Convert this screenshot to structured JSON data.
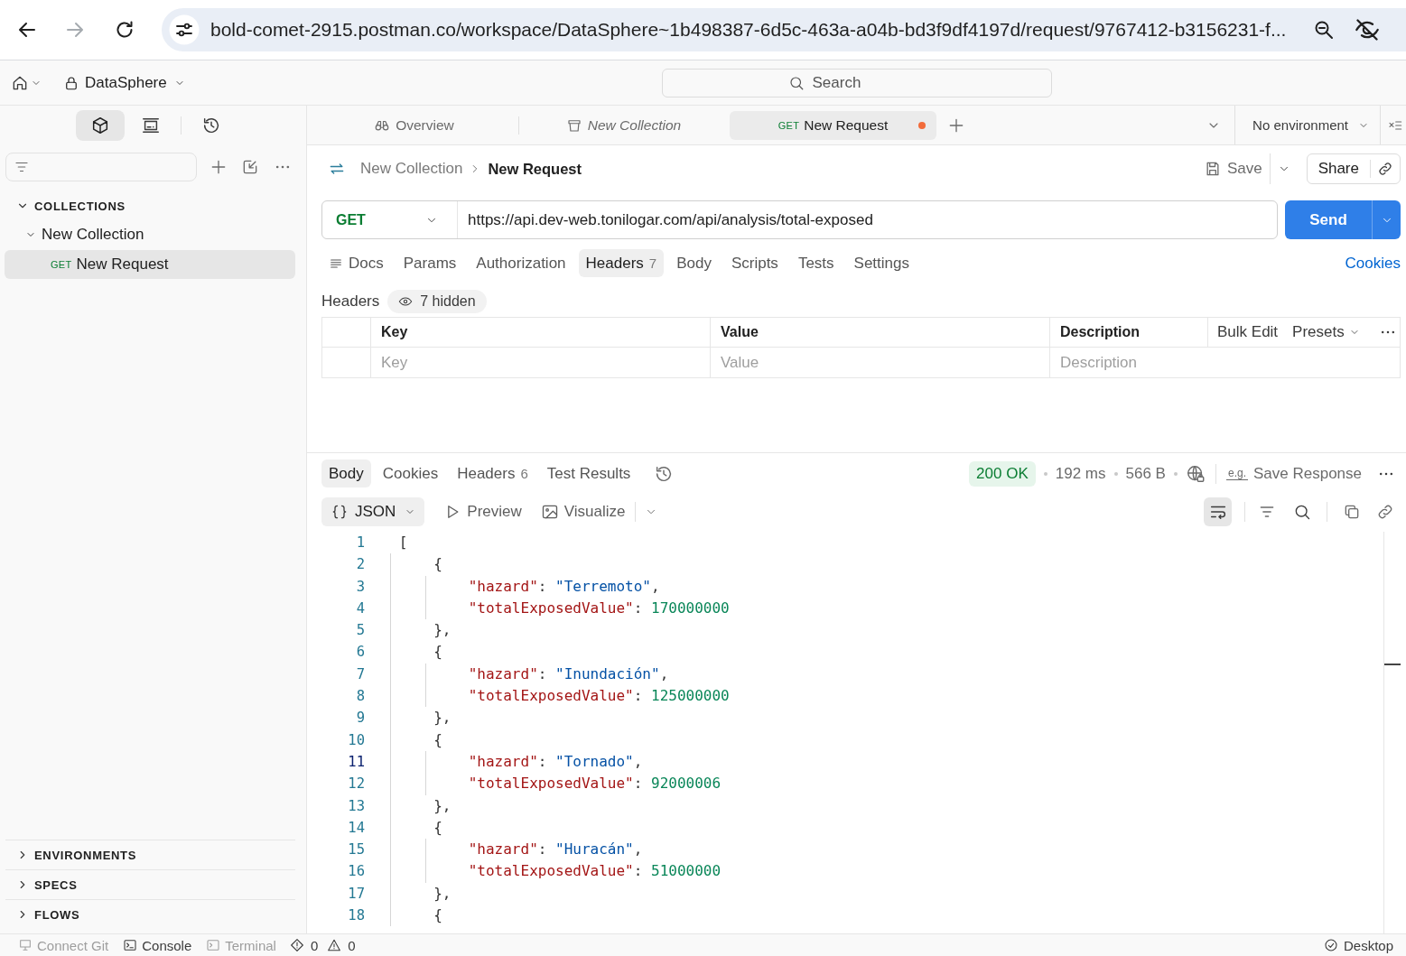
{
  "browser": {
    "url": "bold-comet-2915.postman.co/workspace/DataSphere~1b498387-6d5c-463a-a04b-bd3f9df4197d/request/9767412-b3156231-f...",
    "forward_disabled": true
  },
  "header": {
    "workspace": "DataSphere",
    "search": {
      "placeholder": "Search"
    }
  },
  "sidebar": {
    "icon_tabs": [
      {
        "kind": "collections",
        "selected": true
      },
      {
        "kind": "environments",
        "selected": false
      },
      {
        "kind": "history",
        "selected": false
      }
    ],
    "sections": [
      {
        "label": "COLLECTIONS",
        "expanded": true,
        "children": [
          {
            "label": "New Collection",
            "expanded": true,
            "children": [
              {
                "method": "GET",
                "label": "New Request",
                "selected": true
              }
            ]
          }
        ]
      }
    ],
    "bottom_sections": [
      {
        "label": "ENVIRONMENTS",
        "expanded": false
      },
      {
        "label": "SPECS",
        "expanded": false
      },
      {
        "label": "FLOWS",
        "expanded": false
      }
    ]
  },
  "tabs": [
    {
      "kind": "overview",
      "label": "Overview",
      "selected": false,
      "preview": false,
      "unsaved": false
    },
    {
      "kind": "collection",
      "label": "New Collection",
      "selected": false,
      "preview": true,
      "unsaved": false
    },
    {
      "kind": "request",
      "method": "GET",
      "label": "New Request",
      "selected": true,
      "preview": false,
      "unsaved": true
    }
  ],
  "environment": "No environment",
  "request": {
    "breadcrumb": [
      "New Collection",
      "New Request"
    ],
    "save": "Save",
    "share": "Share",
    "method": "GET",
    "url": "https://api.dev-web.tonilogar.com/api/analysis/total-exposed",
    "send": "Send",
    "tabs": [
      {
        "kind": "docs",
        "label": "Docs",
        "selected": false
      },
      {
        "kind": "plain",
        "label": "Params",
        "selected": false
      },
      {
        "kind": "plain",
        "label": "Authorization",
        "selected": false
      },
      {
        "kind": "plain",
        "label": "Headers",
        "count": "7",
        "selected": true
      },
      {
        "kind": "plain",
        "label": "Body",
        "selected": false
      },
      {
        "kind": "plain",
        "label": "Scripts",
        "selected": false
      },
      {
        "kind": "plain",
        "label": "Tests",
        "selected": false
      },
      {
        "kind": "plain",
        "label": "Settings",
        "selected": false
      }
    ],
    "cookies_link": "Cookies",
    "headers": {
      "title": "Headers",
      "hidden": "7 hidden",
      "columns": [
        "Key",
        "Value",
        "Description"
      ],
      "bulk_edit": "Bulk Edit",
      "presets": "Presets",
      "new_row": [
        {
          "placeholder": "Key"
        },
        {
          "placeholder": "Value"
        },
        {
          "placeholder": "Description"
        }
      ]
    }
  },
  "response": {
    "tabs": [
      {
        "label": "Body",
        "selected": true
      },
      {
        "label": "Cookies",
        "selected": false
      },
      {
        "label": "Headers",
        "count": "6",
        "selected": false
      },
      {
        "label": "Test Results",
        "selected": false
      }
    ],
    "status": "200 OK",
    "time": "192 ms",
    "size": "566 B",
    "save_response": {
      "mark": "e.g.",
      "label": "Save Response"
    },
    "format": "JSON",
    "views": [
      {
        "kind": "preview",
        "label": "Preview"
      },
      {
        "kind": "visualize",
        "label": "Visualize"
      }
    ],
    "wrap": true,
    "lines": [
      {
        "number": "1",
        "current": false,
        "tokens": [
          {
            "kind": "punct",
            "text": "["
          }
        ]
      },
      {
        "number": "2",
        "current": false,
        "tokens": [
          {
            "kind": "punct",
            "text": "    {"
          }
        ]
      },
      {
        "number": "3",
        "current": false,
        "tokens": [
          {
            "kind": "key",
            "text": "        \"hazard\""
          },
          {
            "kind": "punct",
            "text": ": "
          },
          {
            "kind": "string",
            "text": "\"Terremoto\""
          },
          {
            "kind": "punct",
            "text": ","
          }
        ]
      },
      {
        "number": "4",
        "current": false,
        "tokens": [
          {
            "kind": "key",
            "text": "        \"totalExposedValue\""
          },
          {
            "kind": "punct",
            "text": ": "
          },
          {
            "kind": "number",
            "text": "170000000"
          }
        ]
      },
      {
        "number": "5",
        "current": false,
        "tokens": [
          {
            "kind": "punct",
            "text": "    },"
          }
        ]
      },
      {
        "number": "6",
        "current": false,
        "tokens": [
          {
            "kind": "punct",
            "text": "    {"
          }
        ]
      },
      {
        "number": "7",
        "current": false,
        "tokens": [
          {
            "kind": "key",
            "text": "        \"hazard\""
          },
          {
            "kind": "punct",
            "text": ": "
          },
          {
            "kind": "string",
            "text": "\"Inundación\""
          },
          {
            "kind": "punct",
            "text": ","
          }
        ]
      },
      {
        "number": "8",
        "current": false,
        "tokens": [
          {
            "kind": "key",
            "text": "        \"totalExposedValue\""
          },
          {
            "kind": "punct",
            "text": ": "
          },
          {
            "kind": "number",
            "text": "125000000"
          }
        ]
      },
      {
        "number": "9",
        "current": false,
        "tokens": [
          {
            "kind": "punct",
            "text": "    },"
          }
        ]
      },
      {
        "number": "10",
        "current": false,
        "tokens": [
          {
            "kind": "punct",
            "text": "    {"
          }
        ]
      },
      {
        "number": "11",
        "current": true,
        "tokens": [
          {
            "kind": "key",
            "text": "        \"hazard\""
          },
          {
            "kind": "punct",
            "text": ": "
          },
          {
            "kind": "string",
            "text": "\"Tornado\""
          },
          {
            "kind": "punct",
            "text": ","
          }
        ]
      },
      {
        "number": "12",
        "current": false,
        "tokens": [
          {
            "kind": "key",
            "text": "        \"totalExposedValue\""
          },
          {
            "kind": "punct",
            "text": ": "
          },
          {
            "kind": "number",
            "text": "92000006"
          }
        ]
      },
      {
        "number": "13",
        "current": false,
        "tokens": [
          {
            "kind": "punct",
            "text": "    },"
          }
        ]
      },
      {
        "number": "14",
        "current": false,
        "tokens": [
          {
            "kind": "punct",
            "text": "    {"
          }
        ]
      },
      {
        "number": "15",
        "current": false,
        "tokens": [
          {
            "kind": "key",
            "text": "        \"hazard\""
          },
          {
            "kind": "punct",
            "text": ": "
          },
          {
            "kind": "string",
            "text": "\"Huracán\""
          },
          {
            "kind": "punct",
            "text": ","
          }
        ]
      },
      {
        "number": "16",
        "current": false,
        "tokens": [
          {
            "kind": "key",
            "text": "        \"totalExposedValue\""
          },
          {
            "kind": "punct",
            "text": ": "
          },
          {
            "kind": "number",
            "text": "51000000"
          }
        ]
      },
      {
        "number": "17",
        "current": false,
        "tokens": [
          {
            "kind": "punct",
            "text": "    },"
          }
        ]
      },
      {
        "number": "18",
        "current": false,
        "tokens": [
          {
            "kind": "punct",
            "text": "    {"
          }
        ]
      }
    ]
  },
  "status_bar": {
    "items": [
      {
        "kind": "git",
        "label": "Connect Git",
        "disabled": true
      },
      {
        "kind": "console",
        "label": "Console",
        "disabled": false
      },
      {
        "kind": "terminal",
        "label": "Terminal",
        "disabled": true
      }
    ],
    "errors": "0",
    "warnings": "0",
    "mode": "Desktop"
  }
}
